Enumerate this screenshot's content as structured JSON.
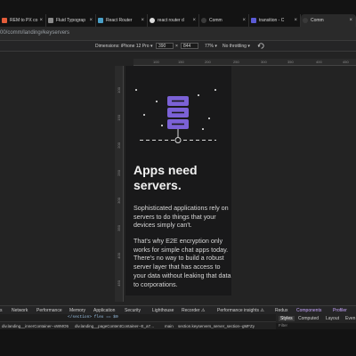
{
  "tabs": [
    {
      "label": "REM to PX co",
      "fav": "#e45d3a"
    },
    {
      "label": "Fluid Typograp",
      "fav": "#8a8a8a"
    },
    {
      "label": "React Router",
      "fav": "#4aa0c8"
    },
    {
      "label": "react router d",
      "fav": "#dddddd"
    },
    {
      "label": "Comm",
      "fav": "#3a3a3a"
    },
    {
      "label": "transition - C",
      "fav": "#5b5bd6"
    },
    {
      "label": "Comm",
      "fav": "#3a3a3a"
    }
  ],
  "tab_close": "×",
  "url": "00/comm/landing#keyservers",
  "devbar": {
    "dimensions_label": "Dimensions: iPhone 12 Pro ▾",
    "width": "390",
    "times": "×",
    "height": "844",
    "zoom": "77% ▾",
    "throttling": "No throttling ▾",
    "rotate_icon": "rotate-icon"
  },
  "ruler_h": [
    "100",
    "150",
    "200",
    "250",
    "300",
    "350",
    "400",
    "450"
  ],
  "ruler_v": [
    "100",
    "150",
    "200",
    "250",
    "300",
    "350",
    "400",
    "450",
    "500"
  ],
  "content": {
    "headline": "Apps need servers.",
    "para1": "Sophisticated applications rely on servers to do things that your devices simply can't.",
    "para2": "That's why E2E encryption only works for simple chat apps today. There's no way to build a robust server layer that has access to your data without leaking that data to corporations."
  },
  "devtools_tabs": [
    "s",
    "Network",
    "Performance",
    "Memory",
    "Application",
    "Security",
    "Lighthouse",
    "Recorder ⚠",
    "Performance insights ⚠",
    "Redux",
    "Components",
    "Profiler"
  ],
  "dom_line": {
    "text": "</section> flex == $0"
  },
  "crumbs": [
    "div.landing__innerContainer--xWMO5",
    "div.landing__pageContentContainer--E_a7…",
    "main",
    "section.keyservers_server_section--gMFZy"
  ],
  "rightpanel": {
    "tabs": [
      "Styles",
      "Computed",
      "Layout",
      "Even"
    ],
    "filter": "Filter"
  },
  "colors": {
    "server_purple": "#7b61d6",
    "accent": "#6e58c8"
  }
}
